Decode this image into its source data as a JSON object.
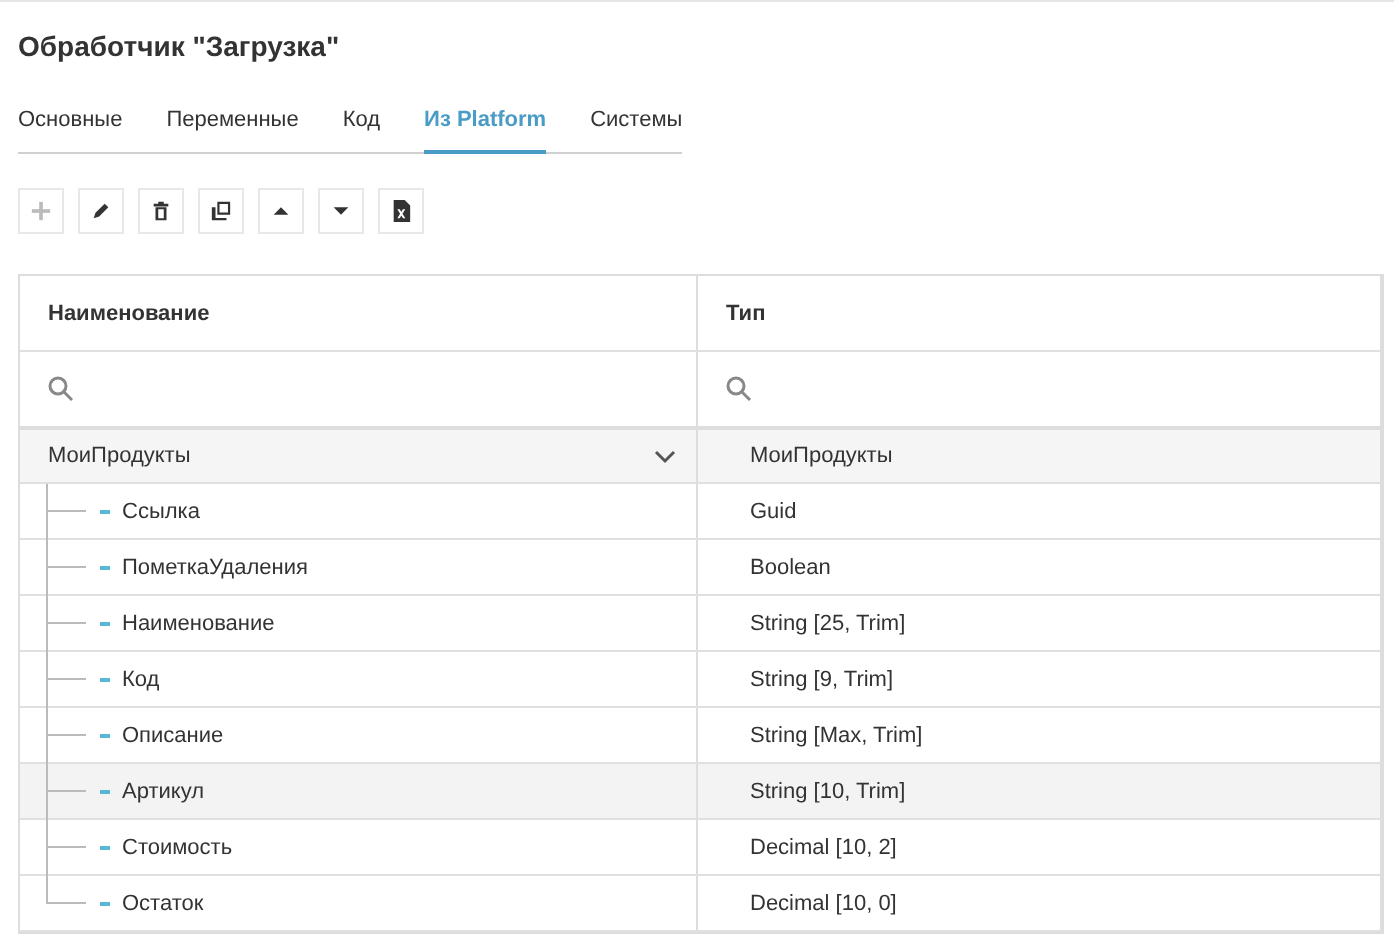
{
  "title": "Обработчик \"Загрузка\"",
  "tabs": [
    {
      "label": "Основные",
      "selected": false
    },
    {
      "label": "Переменные",
      "selected": false
    },
    {
      "label": "Код",
      "selected": false
    },
    {
      "label": "Из Platform",
      "selected": true
    },
    {
      "label": "Системы",
      "selected": false
    }
  ],
  "toolbar": [
    {
      "kind": "add",
      "disabled": true
    },
    {
      "kind": "edit",
      "disabled": false
    },
    {
      "kind": "delete",
      "disabled": false
    },
    {
      "kind": "copy",
      "disabled": false
    },
    {
      "kind": "up",
      "disabled": false
    },
    {
      "kind": "down",
      "disabled": false
    },
    {
      "kind": "excel",
      "disabled": false
    }
  ],
  "table": {
    "columns": [
      "Наименование",
      "Тип"
    ],
    "rows": [
      {
        "name": "МоиПродукты",
        "type": "МоиПродукты",
        "expanded": true,
        "children": [
          {
            "name": "Ссылка",
            "type": "Guid",
            "selected": false
          },
          {
            "name": "ПометкаУдаления",
            "type": "Boolean",
            "selected": false
          },
          {
            "name": "Наименование",
            "type": "String [25, Trim]",
            "selected": false
          },
          {
            "name": "Код",
            "type": "String [9, Trim]",
            "selected": false
          },
          {
            "name": "Описание",
            "type": "String [Max, Trim]",
            "selected": false
          },
          {
            "name": "Артикул",
            "type": "String [10, Trim]",
            "selected": true
          },
          {
            "name": "Стоимость",
            "type": "Decimal [10, 2]",
            "selected": false
          },
          {
            "name": "Остаток",
            "type": "Decimal [10, 0]",
            "selected": false
          }
        ]
      }
    ]
  }
}
